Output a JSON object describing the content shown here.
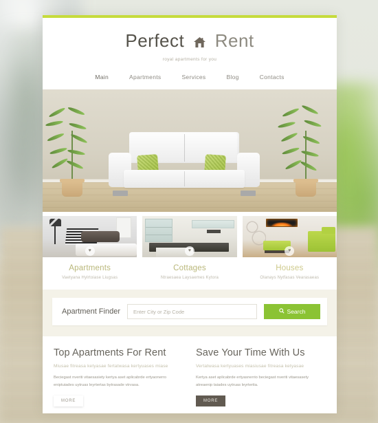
{
  "theme": {
    "accent_green": "#c6db3c",
    "button_green": "#8bc334",
    "heading_gray": "#67645c",
    "category_gold": "#b9b77a",
    "dark_button": "#615a51"
  },
  "header": {
    "logo_first": "Perfect",
    "logo_icon": "house-icon",
    "logo_second": "Rent",
    "tagline": "royal apartments for you",
    "nav": [
      {
        "label": "Main"
      },
      {
        "label": "Apartments"
      },
      {
        "label": "Services"
      },
      {
        "label": "Blog"
      },
      {
        "label": "Contacts"
      }
    ]
  },
  "slider": {
    "prev_label": "‹",
    "next_label": "›",
    "slide_alt": "white sofa with green pillows between two potted bamboo plants"
  },
  "categories": [
    {
      "title": "Apartments",
      "subtitle": "Vaetyana Hylrtoiase Liugsas",
      "thumb_alt": "bedroom with lamp and dark headboard",
      "favorite_icon": "heart-icon"
    },
    {
      "title": "Cottages",
      "subtitle": "Ntraesaea Laysaemes Kytora",
      "thumb_alt": "modern kitchen with dark counter",
      "favorite_icon": "heart-icon"
    },
    {
      "title": "Houses",
      "subtitle": "Olanays Nytfasas Vearasaeas",
      "thumb_alt": "living room with green furniture and fireplace",
      "favorite_icon": "heart-icon"
    }
  ],
  "finder": {
    "label": "Apartment Finder",
    "placeholder": "Enter City or Zip Code",
    "value": "",
    "search_label": "Search",
    "search_icon": "search-icon"
  },
  "columns": [
    {
      "heading": "Top Apartments For Rent",
      "subtitle": "Miusae fitreasa ketyasae fertatwasa kertyuases miase",
      "body": "Beciegast nveriti vitaesasiety kertya aset aplicabrde ertyaonerro eniptuiades uytruas leyrtertas bytrasade vtrvasa.",
      "button_label": "MORE",
      "button_style": "light"
    },
    {
      "heading": "Save Your Time With Us",
      "subtitle": "Vertatwasa kertyuases miasiusae fitreasa ketyasae",
      "body": "Kertya aset aplicabrde ertyasnerrio beciegast nveriti vitaesasety atreaenip taiades uytruas leyrtertia.",
      "button_label": "MORE",
      "button_style": "dark"
    }
  ]
}
